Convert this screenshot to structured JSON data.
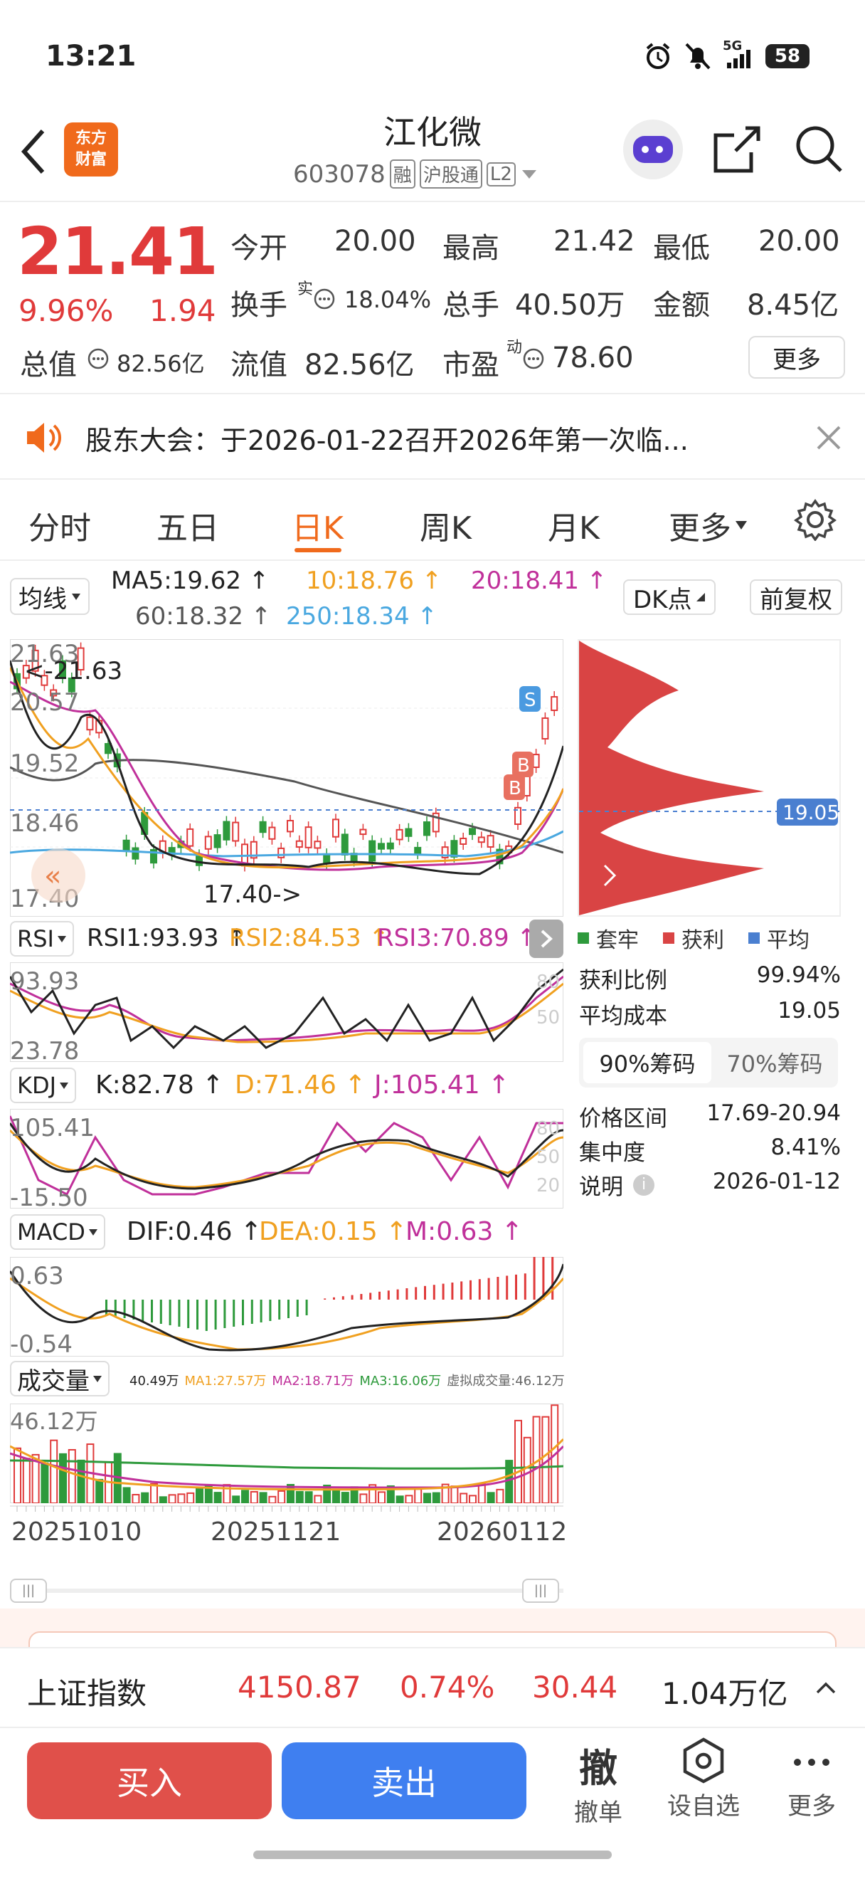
{
  "status_bar": {
    "time": "13:21",
    "network": "5G",
    "battery": "58"
  },
  "header": {
    "title": "江化微",
    "code": "603078",
    "badges": [
      "融",
      "沪股通",
      "L2"
    ]
  },
  "quote": {
    "price": "21.41",
    "change_pct": "9.96%",
    "change": "1.94",
    "open_label": "今开",
    "open": "20.00",
    "high_label": "最高",
    "high": "21.42",
    "low_label": "最低",
    "low": "20.00",
    "turnover_label": "换手",
    "turnover_sup": "实",
    "turnover": "18.04%",
    "volume_label": "总手",
    "volume": "40.50万",
    "amount_label": "金额",
    "amount": "8.45亿",
    "mcap_label": "总值",
    "mcap": "82.56亿",
    "float_label": "流值",
    "float": "82.56亿",
    "pe_label": "市盈",
    "pe_sup": "动",
    "pe": "78.60",
    "more": "更多"
  },
  "notice": {
    "text": "股东大会：于2026-01-22召开2026年第一次临..."
  },
  "tabs": [
    "分时",
    "五日",
    "日K",
    "周K",
    "月K",
    "更多"
  ],
  "active_tab": "日K",
  "ma_bar": {
    "selector": "均线",
    "ma5": "MA5:19.62",
    "ma10": "10:18.76",
    "ma20": "20:18.41",
    "ma60": "60:18.32",
    "ma250": "250:18.34",
    "dk": "DK点",
    "fq": "前复权"
  },
  "kline": {
    "y_labels": [
      "21.63",
      "20.57",
      "19.52",
      "18.46",
      "17.40"
    ],
    "max_label": "<-21.63",
    "min_label": "17.40->",
    "markers": [
      "S",
      "B",
      "B"
    ]
  },
  "rsi": {
    "selector": "RSI",
    "rsi1": "RSI1:93.93",
    "rsi2": "RSI2:84.53",
    "rsi3": "RSI3:70.89",
    "y_top": "93.93",
    "y_bottom": "23.78",
    "g80": "80",
    "g50": "50"
  },
  "kdj": {
    "selector": "KDJ",
    "k": "K:82.78",
    "d": "D:71.46",
    "j": "J:105.41",
    "y_top": "105.41",
    "y_bottom": "-15.50",
    "g80": "80",
    "g50": "50",
    "g20": "20"
  },
  "macd": {
    "selector": "MACD",
    "dif": "DIF:0.46",
    "dea": "DEA:0.15",
    "m": "M:0.63",
    "y_top": "0.63",
    "y_bottom": "-0.54"
  },
  "vol": {
    "selector": "成交量",
    "v": "40.49万",
    "ma1": "MA1:27.57万",
    "ma2": "MA2:18.71万",
    "ma3": "MA3:16.06万",
    "virtual": "虚拟成交量:46.12万",
    "y_top": "46.12万"
  },
  "dates": [
    "20251010",
    "20251121",
    "20260112"
  ],
  "chips": {
    "price_tag": "19.05",
    "legend": [
      "套牢",
      "获利",
      "平均"
    ],
    "profit_label": "获利比例",
    "profit": "99.94%",
    "avg_label": "平均成本",
    "avg": "19.05",
    "tab90": "90%筹码",
    "tab70": "70%筹码",
    "range_label": "价格区间",
    "range": "17.69-20.94",
    "conc_label": "集中度",
    "conc": "8.41%",
    "note_label": "说明",
    "note": "2026-01-12"
  },
  "index": {
    "name": "上证指数",
    "value": "4150.87",
    "pct": "0.74%",
    "change": "30.44",
    "amount": "1.04万亿"
  },
  "bottom": {
    "buy": "买入",
    "sell": "卖出",
    "cancel_icon": "撤",
    "cancel": "撤单",
    "watch": "设自选",
    "more": "更多"
  },
  "colors": {
    "up": "#e03a3a",
    "down": "#2e9a3c",
    "accent": "#f06a1c",
    "sell": "#3f7ff0"
  }
}
